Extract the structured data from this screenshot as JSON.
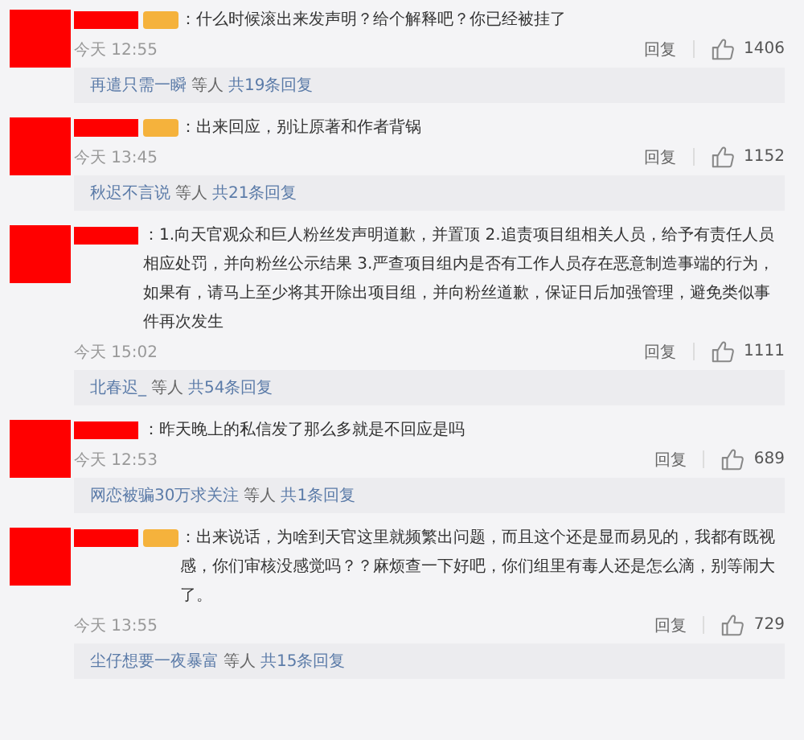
{
  "comments": [
    {
      "badge": true,
      "text": "：什么时候滚出来发声明？给个解释吧？你已经被挂了",
      "time": "今天 12:55",
      "reply": "回复",
      "likes": "1406",
      "thread": {
        "names": "再遣只需一瞬",
        "suffix": "等人",
        "count": "共19条回复"
      }
    },
    {
      "badge": true,
      "text": "：出来回应，别让原著和作者背锅",
      "time": "今天 13:45",
      "reply": "回复",
      "likes": "1152",
      "thread": {
        "names": "秋迟不言说",
        "suffix": "等人",
        "count": "共21条回复"
      }
    },
    {
      "badge": false,
      "text": "：1.向天官观众和巨人粉丝发声明道歉，并置顶 2.追责项目组相关人员，给予有责任人员相应处罚，并向粉丝公示结果 3.严查项目组内是否有工作人员存在恶意制造事端的行为，如果有，请马上至少将其开除出项目组，并向粉丝道歉，保证日后加强管理，避免类似事件再次发生",
      "time": "今天 15:02",
      "reply": "回复",
      "likes": "1111",
      "thread": {
        "names": "北春迟_",
        "suffix": "等人",
        "count": "共54条回复"
      }
    },
    {
      "badge": false,
      "text": "：昨天晚上的私信发了那么多就是不回应是吗",
      "time": "今天 12:53",
      "reply": "回复",
      "likes": "689",
      "thread": {
        "names": "网恋被骗30万求关注",
        "suffix": "等人",
        "count": "共1条回复"
      }
    },
    {
      "badge": true,
      "text": "：出来说话，为啥到天官这里就频繁出问题，而且这个还是显而易见的，我都有既视感，你们审核没感觉吗？？麻烦查一下好吧，你们组里有毒人还是怎么滴，别等闹大了。",
      "time": "今天 13:55",
      "reply": "回复",
      "likes": "729",
      "thread": {
        "names": "尘仔想要一夜暴富",
        "suffix": "等人",
        "count": "共15条回复"
      }
    }
  ]
}
